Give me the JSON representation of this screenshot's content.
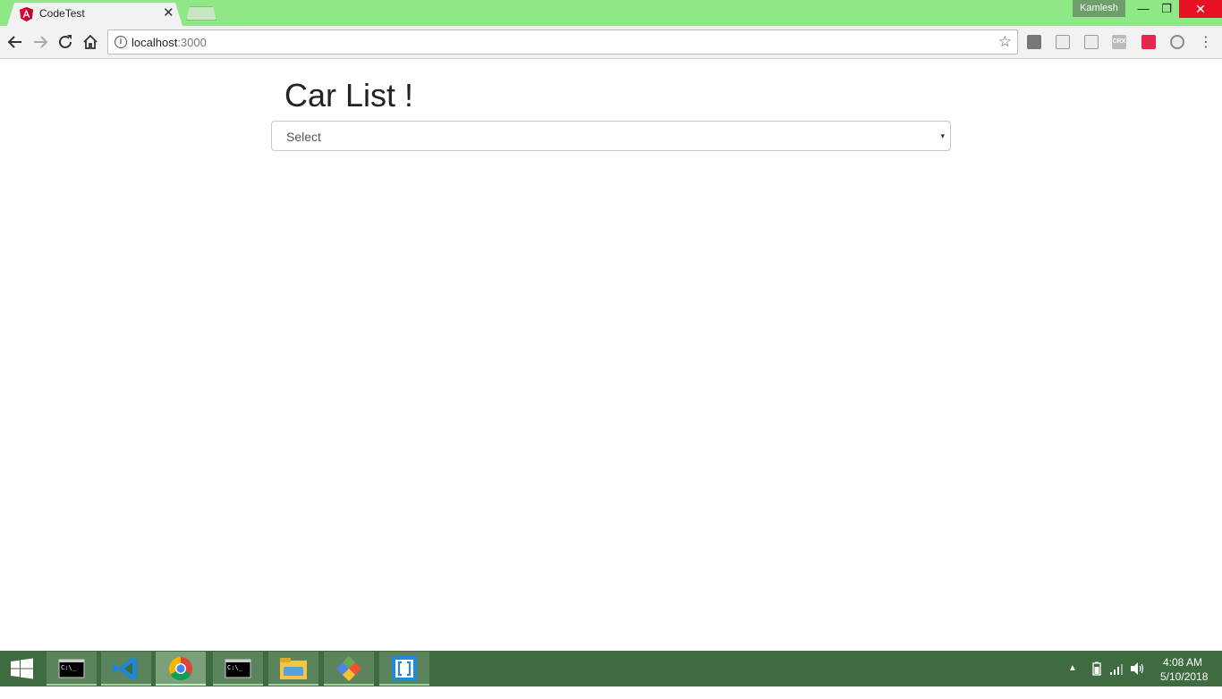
{
  "browser": {
    "tab": {
      "title": "CodeTest",
      "close": "✕"
    },
    "profile_name": "Kamlesh",
    "window_controls": {
      "minimize": "—",
      "maximize": "❐",
      "close": "✕"
    },
    "address": {
      "host": "localhost",
      "port": ":3000"
    },
    "extensions": [
      "ext-icon",
      "grid-icon",
      "grid-icon",
      "crx-icon",
      "vitals-icon",
      "satellite-icon"
    ],
    "colors": {
      "frame": "#8ee886",
      "close_hover": "#e81123"
    }
  },
  "page": {
    "title": "Car List !",
    "select": {
      "value": "Select",
      "caret": "▾"
    }
  },
  "taskbar": {
    "items": [
      "start-icon",
      "cmd-icon",
      "vscode-icon",
      "chrome-icon",
      "cmd-icon",
      "file-explorer-icon",
      "git-icon",
      "brackets-icon"
    ],
    "clock": {
      "time": "4:08 AM",
      "date": "5/10/2018"
    },
    "colors": {
      "background": "#3f6b40"
    }
  }
}
